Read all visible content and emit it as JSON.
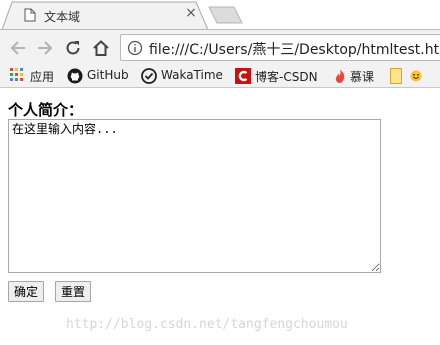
{
  "browser": {
    "tab": {
      "title": "文本域",
      "close_glyph": "×"
    },
    "address": {
      "url": "file:///C:/Users/燕十三/Desktop/htmltest.htm"
    },
    "bookmarks": [
      {
        "label": "应用",
        "icon": "apps-grid-icon"
      },
      {
        "label": "GitHub",
        "icon": "github-icon"
      },
      {
        "label": "WakaTime",
        "icon": "wakatime-icon"
      },
      {
        "label": "博客-CSDN",
        "icon": "csdn-icon"
      },
      {
        "label": "慕课",
        "icon": "imooc-flame-icon"
      },
      {
        "label": "",
        "icon": "folder-icon"
      },
      {
        "label": "",
        "icon": "smiley-icon"
      }
    ]
  },
  "form": {
    "label": "个人简介：",
    "textarea_value": "在这里输入内容...",
    "submit_label": "确定",
    "reset_label": "重置"
  },
  "watermark": "http://blog.csdn.net/tangfengchoumou"
}
